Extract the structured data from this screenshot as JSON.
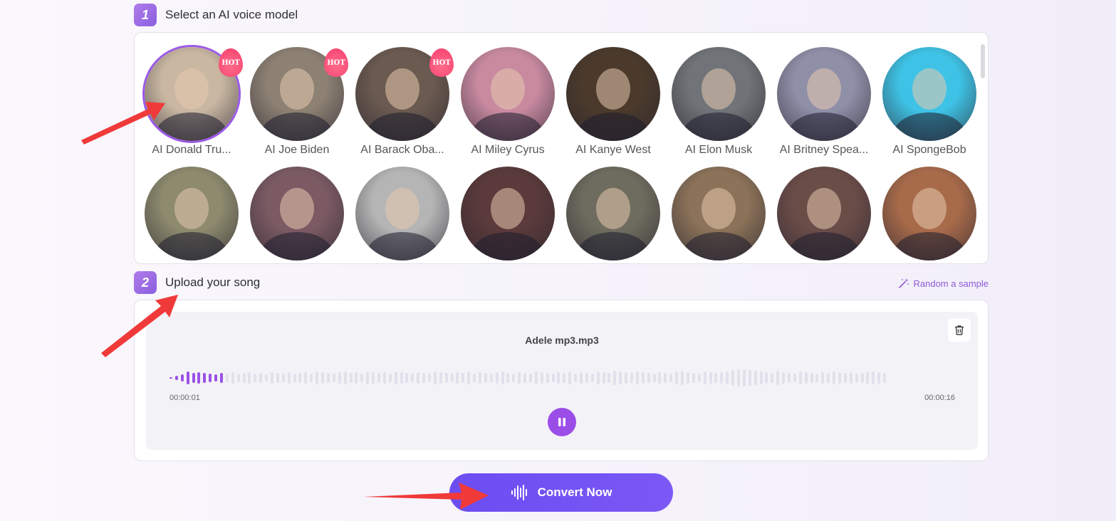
{
  "step1": {
    "number": "1",
    "title": "Select an AI voice model"
  },
  "step2": {
    "number": "2",
    "title": "Upload your song"
  },
  "random_sample": "Random a sample",
  "voices_row1": [
    {
      "label": "AI Donald Tru...",
      "hot": "HOT",
      "color": "#c9b7a2"
    },
    {
      "label": "AI Joe Biden",
      "hot": "HOT",
      "color": "#8d8173"
    },
    {
      "label": "AI Barack Oba...",
      "hot": "HOT",
      "color": "#6a5a4f"
    },
    {
      "label": "AI Miley Cyrus",
      "hot": "",
      "color": "#c98aa0"
    },
    {
      "label": "AI Kanye West",
      "hot": "",
      "color": "#4b3a2b"
    },
    {
      "label": "AI Elon Musk",
      "hot": "",
      "color": "#707478"
    },
    {
      "label": "AI Britney Spea...",
      "hot": "",
      "color": "#8f8fa8"
    },
    {
      "label": "AI SpongeBob",
      "hot": "",
      "color": "#3ec3e6"
    }
  ],
  "voices_row2_colors": [
    "#8d8a6e",
    "#7b5a63",
    "#b5b5b5",
    "#5a3a3a",
    "#6e6c5e",
    "#8b7258",
    "#6b4d48",
    "#a86b4a"
  ],
  "player": {
    "file_name": "Adele mp3.mp3",
    "time_current": "00:00:01",
    "time_total": "00:00:16",
    "played_fraction": 0.07
  },
  "convert_button": "Convert Now",
  "accent": "#9b52e6"
}
